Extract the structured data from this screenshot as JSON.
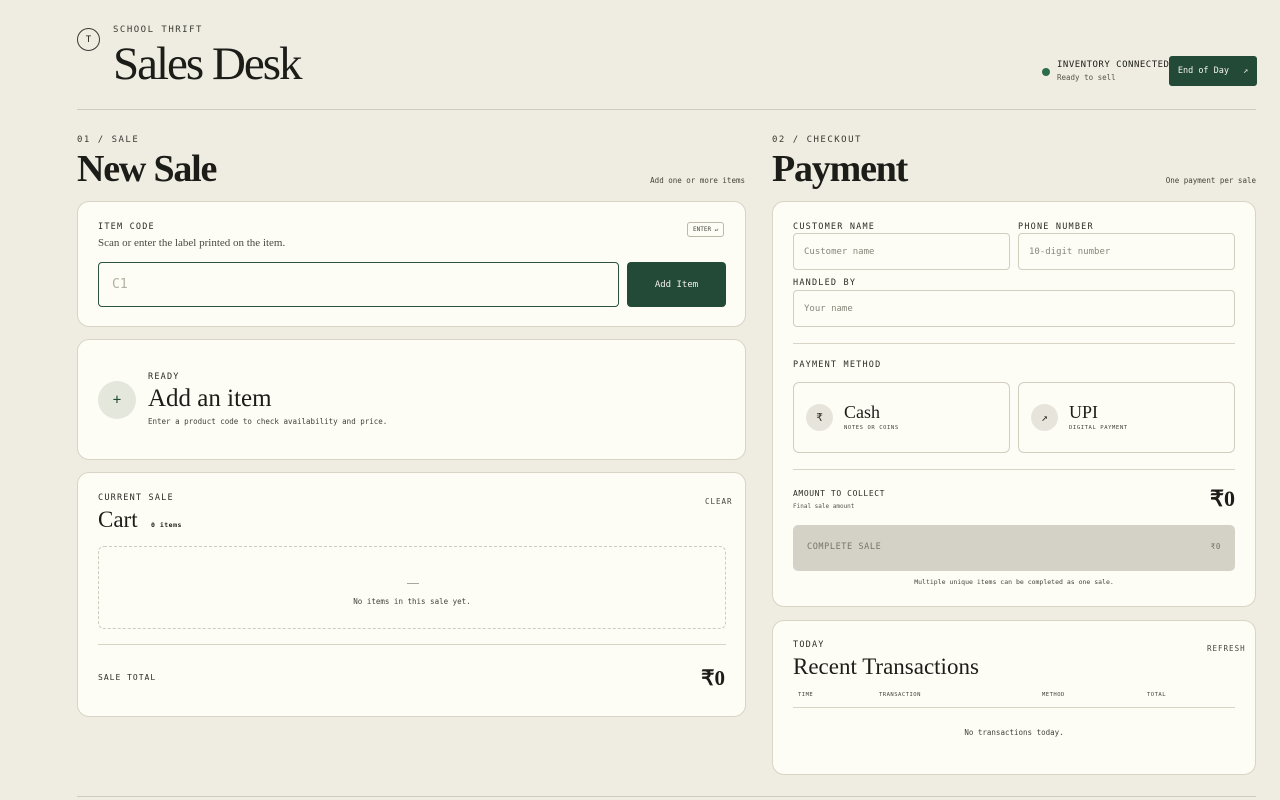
{
  "header": {
    "logo_letter": "T",
    "eyebrow": "SCHOOL THRIFT",
    "title": "Sales Desk",
    "status_title": "INVENTORY CONNECTED",
    "status_sub": "Ready to sell",
    "eod_label": "End of Day",
    "eod_icon": "↗"
  },
  "sale": {
    "eyebrow": "01 / SALE",
    "title": "New Sale",
    "note": "Add one or more items",
    "item_code_label": "ITEM CODE",
    "item_code_helper": "Scan or enter the label printed on the item.",
    "enter_badge": "ENTER ↵",
    "code_placeholder": "C1",
    "add_button": "Add Item",
    "ready_icon": "+",
    "ready_eyebrow": "READY",
    "ready_title": "Add an item",
    "ready_sub": "Enter a product code to check availability and price.",
    "cart_eyebrow": "CURRENT SALE",
    "cart_title": "Cart",
    "cart_count": "0 items",
    "clear_label": "CLEAR",
    "empty_text": "No items in this sale yet.",
    "total_label": "SALE TOTAL",
    "total_value": "₹0"
  },
  "checkout": {
    "eyebrow": "02 / CHECKOUT",
    "title": "Payment",
    "note": "One payment per sale",
    "customer_label": "CUSTOMER NAME",
    "customer_placeholder": "Customer name",
    "phone_label": "PHONE NUMBER",
    "phone_placeholder": "10-digit number",
    "handled_label": "HANDLED BY",
    "handled_placeholder": "Your name",
    "method_label": "PAYMENT METHOD",
    "methods": [
      {
        "icon": "₹",
        "title": "Cash",
        "sub": "NOTES OR COINS"
      },
      {
        "icon": "↗",
        "title": "UPI",
        "sub": "DIGITAL PAYMENT"
      }
    ],
    "amount_label": "AMOUNT TO COLLECT",
    "amount_sub": "Final sale amount",
    "amount_value": "₹0",
    "complete_label": "COMPLETE SALE",
    "complete_amount": "₹0",
    "fine_print": "Multiple unique items can be completed as one sale."
  },
  "transactions": {
    "eyebrow": "TODAY",
    "title": "Recent Transactions",
    "refresh_label": "REFRESH",
    "columns": [
      "TIME",
      "TRANSACTION",
      "METHOD",
      "TOTAL"
    ],
    "empty_text": "No transactions today."
  },
  "colors": {
    "accent": "#224a37",
    "background": "#efede2",
    "card": "#fdfcf5",
    "status_dot": "#2c6b4b"
  }
}
